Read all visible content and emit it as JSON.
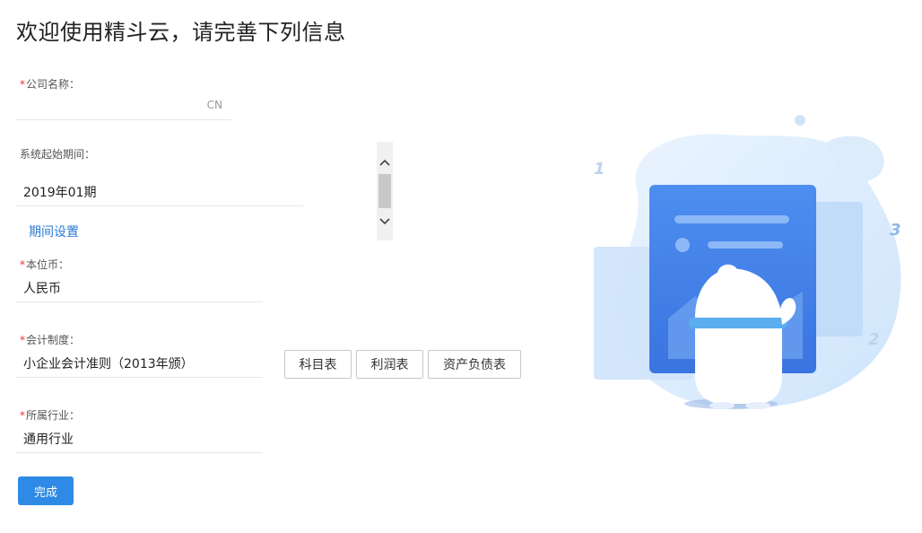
{
  "title": "欢迎使用精斗云，请完善下列信息",
  "form": {
    "required_mark": "*",
    "company_name": {
      "label": "公司名称：",
      "value": "",
      "suffix": "CN"
    },
    "start_period": {
      "label": "系统起始期间：",
      "value": "2019年01期",
      "link": "期间设置"
    },
    "currency": {
      "label": "本位币：",
      "value": "人民币"
    },
    "accounting_system": {
      "label": "会计制度：",
      "value": "小企业会计准则（2013年颁）"
    },
    "industry": {
      "label": "所属行业：",
      "value": "通用行业"
    }
  },
  "report_buttons": [
    "科目表",
    "利润表",
    "资产负债表"
  ],
  "submit_label": "完成",
  "illustration": {
    "numbers": [
      "1",
      "2",
      "3"
    ]
  },
  "colors": {
    "primary": "#2f8ae5",
    "link": "#2b7bd6",
    "required": "#e33333"
  }
}
